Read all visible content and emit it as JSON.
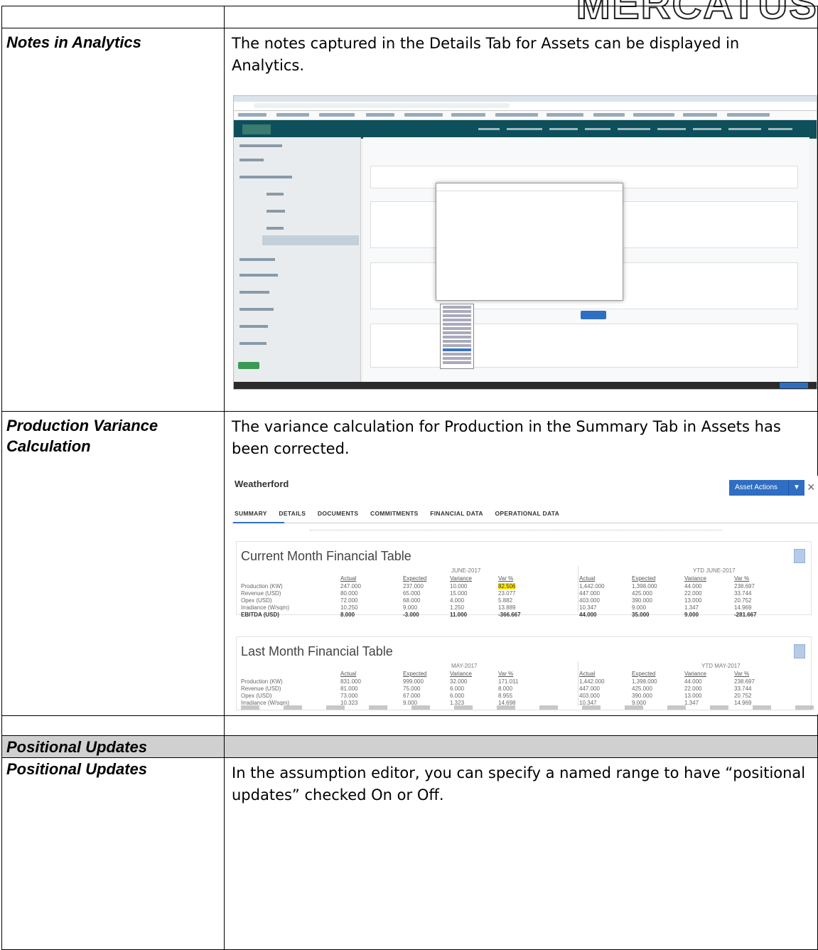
{
  "rows": [
    {
      "label": "",
      "description": ""
    },
    {
      "label": "Notes in Analytics",
      "description": "The notes captured in the Details Tab for Assets can be displayed in Analytics."
    },
    {
      "label": "Production Variance Calculation",
      "description": "The variance calculation for Production in the Summary Tab in Assets has been corrected."
    },
    {
      "label": "",
      "description": ""
    },
    {
      "label": "Positional Updates",
      "description": ""
    },
    {
      "label": "Positional Updates",
      "description": "In the assumption editor, you can specify a named range to have “positional updates” checked On or Off."
    }
  ],
  "asset_view": {
    "title": "Weatherford",
    "actions_label": "Asset Actions",
    "close_glyph": "×",
    "tabs": [
      "SUMMARY",
      "DETAILS",
      "DOCUMENTS",
      "COMMITMENTS",
      "FINANCIAL DATA",
      "OPERATIONAL DATA"
    ],
    "columns": [
      "Actual",
      "Expected",
      "Variance",
      "Var %",
      "Actual",
      "Expected",
      "Variance",
      "Var %"
    ],
    "current_month": {
      "title": "Current Month Financial Table",
      "period": "JUNE-2017",
      "ytd_period": "YTD JUNE-2017",
      "rows": [
        {
          "label": "Production (KW)",
          "values": [
            "247.000",
            "237.000",
            "10.000",
            "82.506",
            "1,442.000",
            "1,398.000",
            "44.000",
            "238.697"
          ]
        },
        {
          "label": "Revenue (USD)",
          "values": [
            "80.000",
            "65.000",
            "15.000",
            "23.077",
            "447.000",
            "425.000",
            "22.000",
            "33.744"
          ]
        },
        {
          "label": "Opex (USD)",
          "values": [
            "72.000",
            "68.000",
            "4.000",
            "5.882",
            "403.000",
            "390.000",
            "13.000",
            "20.752"
          ]
        },
        {
          "label": "Irradiance (W/sqm)",
          "values": [
            "10.250",
            "9.000",
            "1.250",
            "13.889",
            "10.347",
            "9.000",
            "1.347",
            "14.969"
          ]
        },
        {
          "label": "EBITDA (USD)",
          "values": [
            "8.000",
            "-3.000",
            "11.000",
            "-366.667",
            "44.000",
            "35.000",
            "9.000",
            "-281.667"
          ]
        }
      ]
    },
    "last_month": {
      "title": "Last Month Financial Table",
      "period": "MAY-2017",
      "ytd_period": "YTD MAY-2017",
      "rows": [
        {
          "label": "Production (KW)",
          "values": [
            "831.000",
            "999.000",
            "32.000",
            "171.011",
            "1,442.000",
            "1,398.000",
            "44.000",
            "238.697"
          ]
        },
        {
          "label": "Revenue (USD)",
          "values": [
            "81.000",
            "75.000",
            "6.000",
            "8.000",
            "447.000",
            "425.000",
            "22.000",
            "33.744"
          ]
        },
        {
          "label": "Opex (USD)",
          "values": [
            "73.000",
            "67.000",
            "6.000",
            "8.955",
            "403.000",
            "390.000",
            "13.000",
            "20.752"
          ]
        },
        {
          "label": "Irradiance (W/sqm)",
          "values": [
            "10.323",
            "9.000",
            "1.323",
            "14.698",
            "10.347",
            "9.000",
            "1.347",
            "14.969"
          ]
        }
      ]
    }
  },
  "colors": {
    "accent": "#2f6ec2",
    "highlight": "#ffea00",
    "app_bar": "#0e4f5c",
    "section_row": "#d0d0d0"
  }
}
